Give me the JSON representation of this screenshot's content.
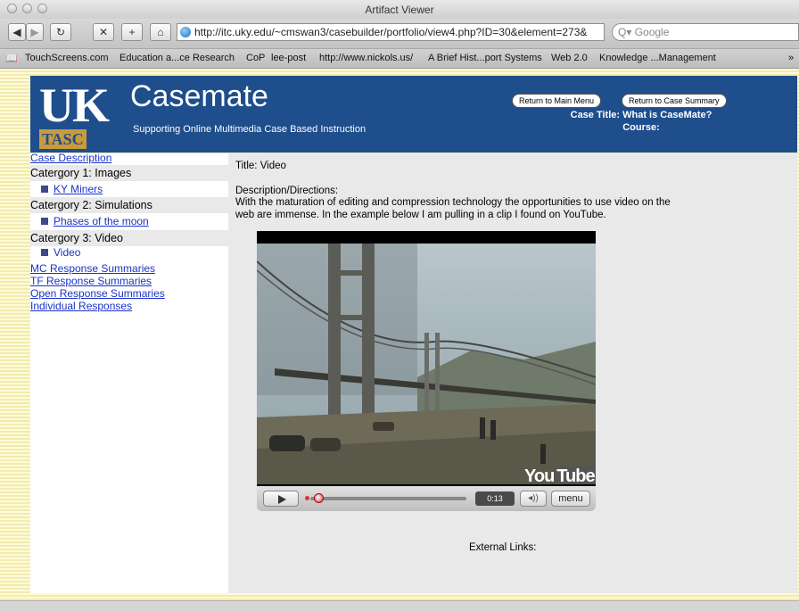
{
  "window": {
    "title": "Artifact Viewer"
  },
  "toolbar": {
    "url": "http://itc.uky.edu/~cmswan3/casebuilder/portfolio/view4.php?ID=30&element=273&",
    "search_placeholder": "Google"
  },
  "bookmarks": [
    "TouchScreens.com",
    "Education a...ce Research",
    "CoP",
    "lee-post",
    "http://www.nickols.us/",
    "A Brief Hist...port Systems",
    "Web 2.0",
    "Knowledge ...Management"
  ],
  "header": {
    "logo_uk": "UK",
    "logo_tasc": "TASC",
    "site_title": "Casemate",
    "tagline": "Supporting Online Multimedia Case Based Instruction",
    "btn_main_menu": "Return to Main Menu",
    "btn_case_summary": "Return to Case Summary",
    "case_title": "Case Title: What is CaseMate?",
    "course": "Course:"
  },
  "sidebar": {
    "case_description": "Case Description",
    "categories": [
      {
        "label": "Catergory 1: Images",
        "item": "KY Miners"
      },
      {
        "label": "Catergory 2: Simulations",
        "item": "Phases of the moon"
      },
      {
        "label": "Catergory 3: Video",
        "item": "Video"
      }
    ],
    "links": [
      "MC Response Summaries",
      "TF Response Summaries",
      "Open Response Summaries",
      "Individual Responses"
    ]
  },
  "main": {
    "title": "Title: Video",
    "desc_label": "Description/Directions:",
    "desc_line1": "With the maturation of editing and compression technology the opportunities to use video on the",
    "desc_line2": "web are immense. In the example below I am pulling in a clip I found on YouTube.",
    "external_links": "External Links:"
  },
  "video": {
    "time": "0:13",
    "menu_label": "menu",
    "watermark_you": "You",
    "watermark_tube": "Tube",
    "volume_icon": "speaker-icon",
    "progress_fraction": 0.02
  }
}
